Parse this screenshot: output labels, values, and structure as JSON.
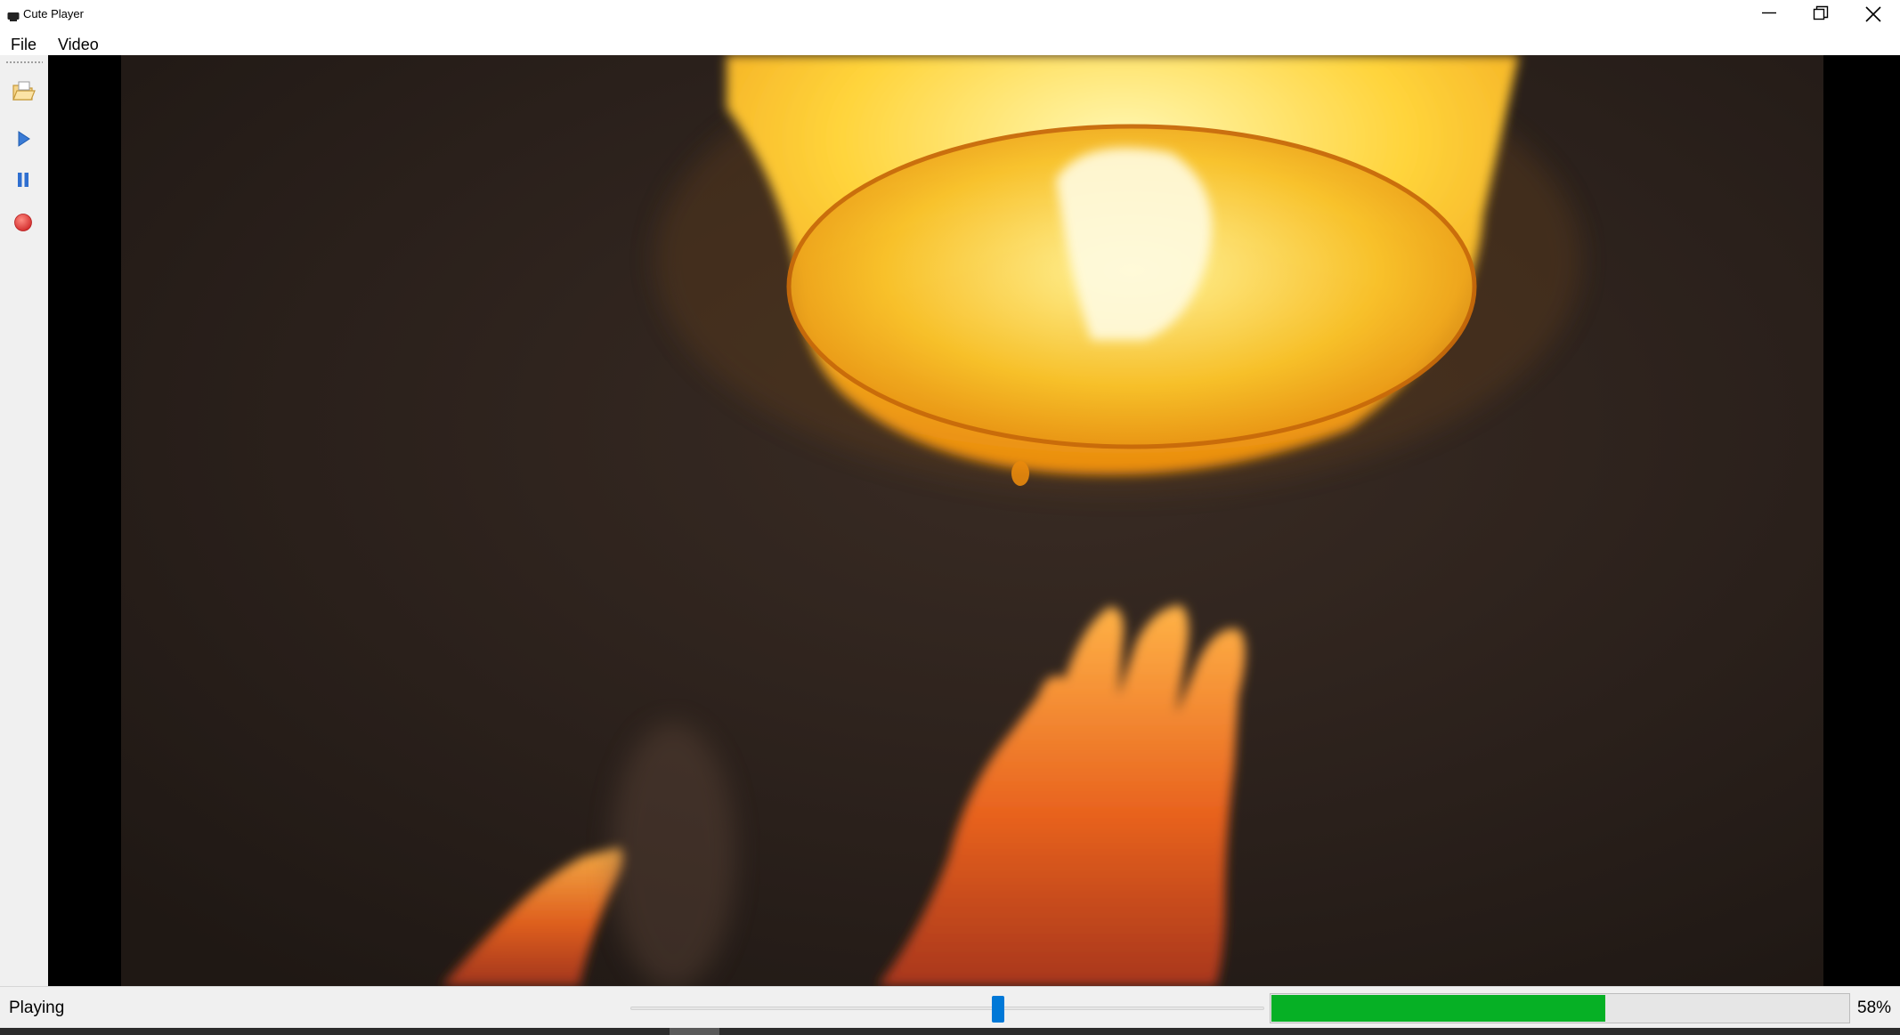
{
  "window": {
    "title": "Cute Player",
    "controls": {
      "minimize": "minimize-icon",
      "restore": "restore-icon",
      "close": "close-icon"
    }
  },
  "menu": [
    {
      "label": "File"
    },
    {
      "label": "Video"
    }
  ],
  "toolbar": {
    "buttons": [
      {
        "icon": "open-folder-icon"
      },
      {
        "icon": "play-icon"
      },
      {
        "icon": "pause-icon"
      },
      {
        "icon": "record-icon"
      }
    ]
  },
  "video": {
    "content": "sky lantern released by hands at night"
  },
  "status": {
    "state": "Playing",
    "seek_position": 0.58,
    "progress_value": 58,
    "progress_label": "58%"
  },
  "colors": {
    "accent": "#0078d7",
    "progress_fill": "#06b025",
    "record": "#e53935",
    "play": "#3a7bd5"
  }
}
